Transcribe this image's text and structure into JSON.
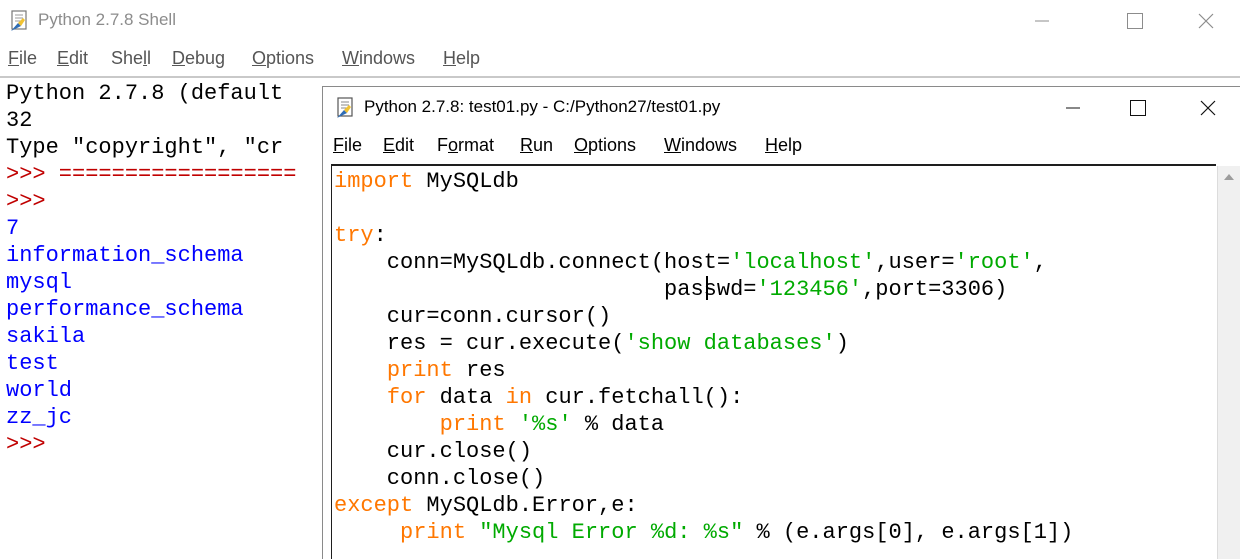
{
  "shell": {
    "title": "Python 2.7.8 Shell",
    "menu": [
      {
        "u": "F",
        "rest": "ile"
      },
      {
        "u": "E",
        "rest": "dit"
      },
      {
        "u": "",
        "pre": "She",
        "u2": "l",
        "rest": "l"
      },
      {
        "u": "D",
        "rest": "ebug"
      },
      {
        "u": "O",
        "rest": "ptions"
      },
      {
        "u": "W",
        "rest": "indows"
      },
      {
        "u": "H",
        "rest": "elp"
      }
    ],
    "lines": [
      "Python 2.7.8 (default",
      "32",
      "Type \"copyright\", \"cr",
      ">>> ==================",
      ">>>",
      "7",
      "information_schema",
      "mysql",
      "performance_schema",
      "sakila",
      "test",
      "world",
      "zz_jc",
      ">>>"
    ]
  },
  "editor": {
    "title": "Python 2.7.8: test01.py - C:/Python27/test01.py",
    "menu": [
      "File",
      "Edit",
      "Format",
      "Run",
      "Options",
      "Windows",
      "Help"
    ],
    "code": [
      "import MySQLdb",
      "",
      "try:",
      "    conn=MySQLdb.connect(host='localhost',user='root',",
      "                         passwd='123456',port=3306)",
      "    cur=conn.cursor()",
      "    res = cur.execute('show databases')",
      "    print res",
      "    for data in cur.fetchall():",
      "        print '%s' % data",
      "    cur.close()",
      "    conn.close()",
      "except MySQLdb.Error,e:",
      "     print \"Mysql Error %d: %s\" % (e.args[0], e.args[1])"
    ]
  },
  "icons": {
    "app": "python-idle-icon",
    "minimize": "minimize-icon",
    "maximize": "maximize-icon",
    "close": "close-icon"
  }
}
